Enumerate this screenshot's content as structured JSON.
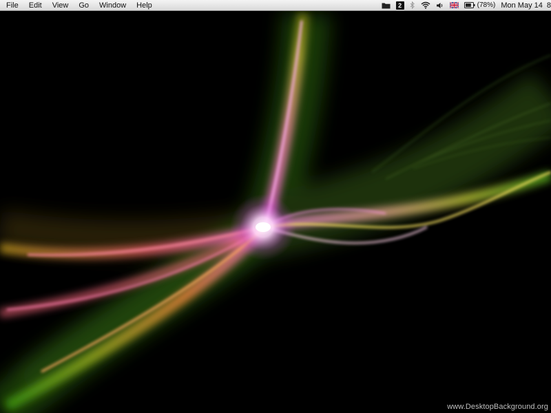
{
  "menubar": {
    "menus": [
      {
        "label": "File"
      },
      {
        "label": "Edit"
      },
      {
        "label": "View"
      },
      {
        "label": "Go"
      },
      {
        "label": "Window"
      },
      {
        "label": "Help"
      }
    ],
    "status": {
      "folder_icon": "folder-icon",
      "badge_number": "2",
      "bluetooth_icon": "bluetooth-icon",
      "wifi_icon": "wifi-icon",
      "volume_icon": "speaker-icon",
      "input_source_icon": "uk-flag-icon",
      "battery_icon": "battery-icon",
      "battery_percent": "(78%)",
      "battery_level": 0.78,
      "clock": "Mon May 14",
      "clock_overflow": "8"
    }
  },
  "desktop": {
    "watermark": "www.DesktopBackground.org"
  },
  "colors": {
    "menubar_top": "#f4f4f4",
    "menubar_bottom": "#d9d9d9",
    "background": "#000000"
  }
}
